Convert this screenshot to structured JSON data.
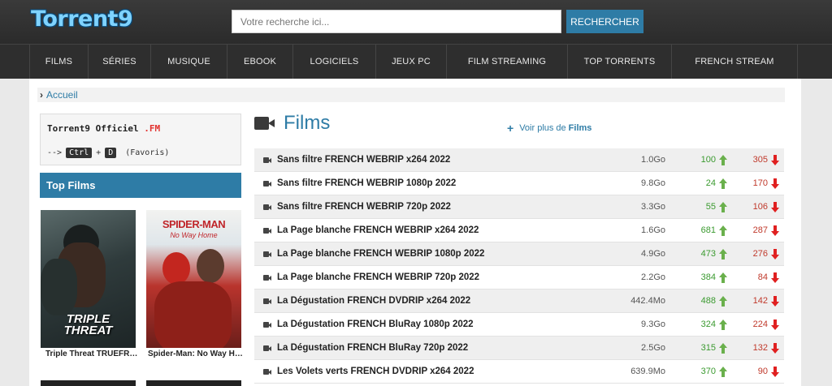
{
  "header": {
    "logo": "Torrent9",
    "search_placeholder": "Votre recherche ici...",
    "search_button": "RECHERCHER"
  },
  "nav": [
    {
      "label": "FILMS",
      "w": 72
    },
    {
      "label": "SÉRIES",
      "w": 77
    },
    {
      "label": "MUSIQUE",
      "w": 94
    },
    {
      "label": "EBOOK",
      "w": 81
    },
    {
      "label": "LOGICIELS",
      "w": 102
    },
    {
      "label": "JEUX PC",
      "w": 87
    },
    {
      "label": "FILM STREAMING",
      "w": 149
    },
    {
      "label": "TOP TORRENTS",
      "w": 128
    },
    {
      "label": "FRENCH STREAM",
      "w": 156
    }
  ],
  "breadcrumb": {
    "home": "Accueil"
  },
  "promo": {
    "title": "Torrent9 Officiel ",
    "title_suffix": ".FM",
    "keys_prefix": "-->",
    "key1": "Ctrl",
    "plus": "+",
    "key2": "D",
    "keys_suffix": "(Favoris)"
  },
  "sidebar": {
    "top_films_title": "Top Films",
    "films": [
      {
        "caption": "Triple Threat TRUEFRENCH",
        "poster_text": "TRIPLE THREAT"
      },
      {
        "caption": "Spider-Man: No Way Home",
        "poster_text": "SPIDER-MAN",
        "poster_sub": "No Way Home"
      }
    ]
  },
  "main": {
    "title": "Films",
    "voir_prefix": "Voir plus de",
    "voir_link": "Films"
  },
  "torrents": [
    {
      "name": "Sans filtre FRENCH WEBRIP x264 2022",
      "size": "1.0Go",
      "seeders": "100",
      "leechers": "305"
    },
    {
      "name": "Sans filtre FRENCH WEBRIP 1080p 2022",
      "size": "9.8Go",
      "seeders": "24",
      "leechers": "170"
    },
    {
      "name": "Sans filtre FRENCH WEBRIP 720p 2022",
      "size": "3.3Go",
      "seeders": "55",
      "leechers": "106"
    },
    {
      "name": "La Page blanche FRENCH WEBRIP x264 2022",
      "size": "1.6Go",
      "seeders": "681",
      "leechers": "287"
    },
    {
      "name": "La Page blanche FRENCH WEBRIP 1080p 2022",
      "size": "4.9Go",
      "seeders": "473",
      "leechers": "276"
    },
    {
      "name": "La Page blanche FRENCH WEBRIP 720p 2022",
      "size": "2.2Go",
      "seeders": "384",
      "leechers": "84"
    },
    {
      "name": "La Dégustation FRENCH DVDRIP x264 2022",
      "size": "442.4Mo",
      "seeders": "488",
      "leechers": "142"
    },
    {
      "name": "La Dégustation FRENCH BluRay 1080p 2022",
      "size": "9.3Go",
      "seeders": "324",
      "leechers": "224"
    },
    {
      "name": "La Dégustation FRENCH BluRay 720p 2022",
      "size": "2.5Go",
      "seeders": "315",
      "leechers": "132"
    },
    {
      "name": "Les Volets verts FRENCH DVDRIP x264 2022",
      "size": "639.9Mo",
      "seeders": "370",
      "leechers": "90"
    }
  ],
  "colors": {
    "accent": "#2e7ca6",
    "seed": "#3a9a2f",
    "leech": "#c0392b",
    "header_bg": "#2e2e2e"
  }
}
